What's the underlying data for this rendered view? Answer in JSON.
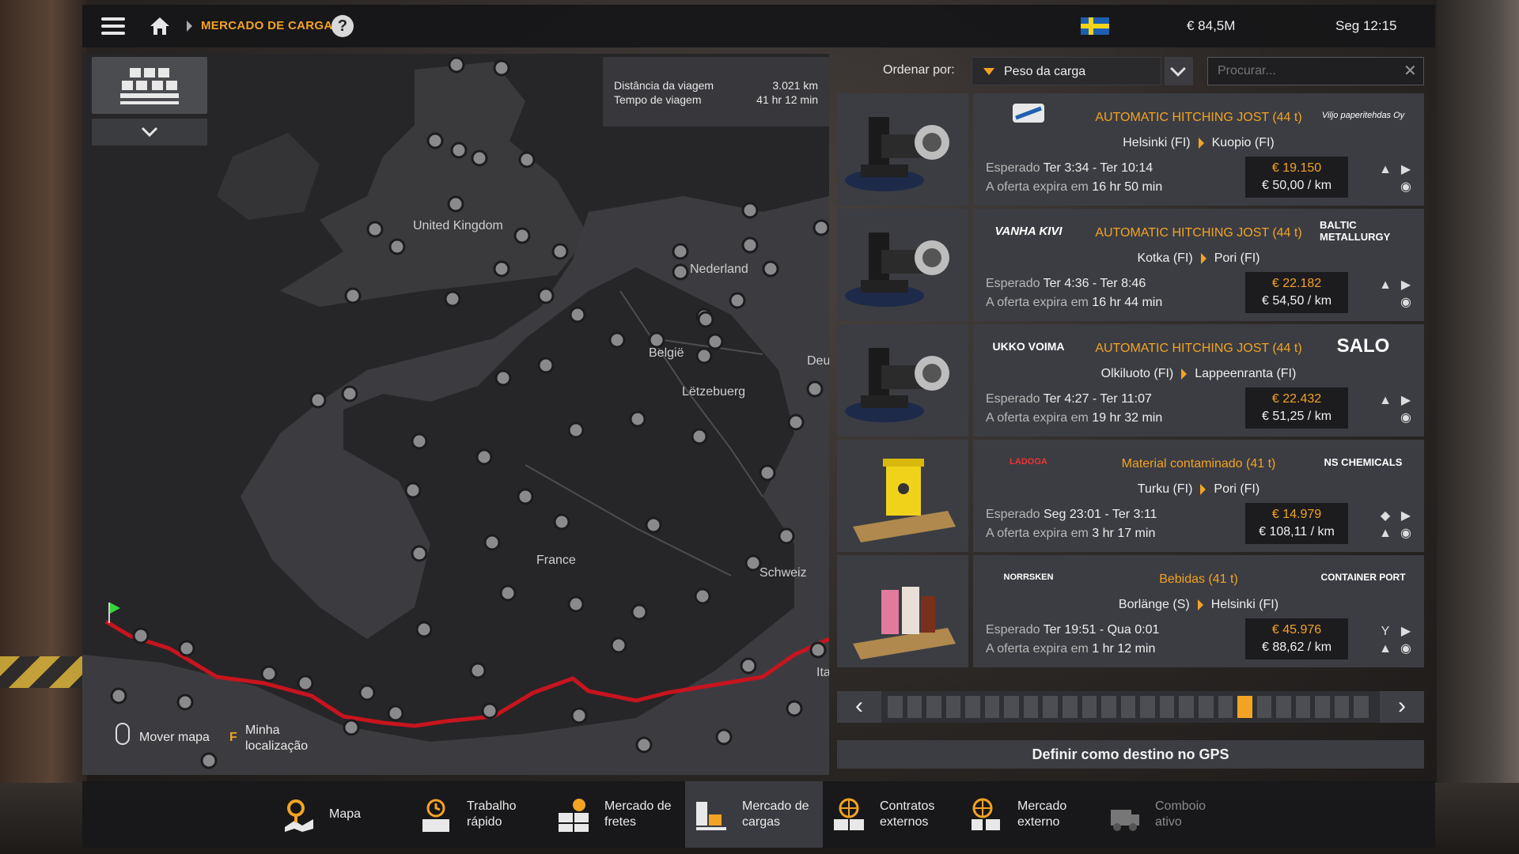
{
  "topbar": {
    "breadcrumb": "MERCADO DE CARGAS",
    "help": "?",
    "money": "€ 84,5M",
    "clock": "Seg 12:15"
  },
  "map": {
    "trip_distance_label": "Distância da viagem",
    "trip_distance_value": "3.021 km",
    "trip_time_label": "Tempo de viagem",
    "trip_time_value": "41 hr 12 min",
    "labels": [
      "United Kingdom",
      "Nederland",
      "België",
      "Lëtzebuerg",
      "France",
      "Schweiz",
      "Deu",
      "Ita"
    ],
    "move_map": "Mover mapa",
    "my_location_key": "F",
    "my_location": "Minha localização"
  },
  "sort": {
    "label": "Ordenar por:",
    "value": "Peso da carga",
    "search_placeholder": "Procurar..."
  },
  "jobs": [
    {
      "company_from_logo": "FennoBaltica",
      "company_to_logo": "Viljo paperitehdas Oy",
      "cargo": "AUTOMATIC HITCHING JOST (44 t)",
      "from": "Helsinki (FI)",
      "to": "Kuopio (FI)",
      "expected_label": "Esperado",
      "expected": "Ter 3:34 - Ter 10:14",
      "offer_label": "A oferta expira em",
      "offer": "16 hr 50 min",
      "price": "€ 19.150",
      "per_km": "€ 50,00 / km"
    },
    {
      "company_from_logo": "VANHA KIVI",
      "company_to_logo": "BALTIC METALLURGY",
      "cargo": "AUTOMATIC HITCHING JOST (44 t)",
      "from": "Kotka (FI)",
      "to": "Pori (FI)",
      "expected_label": "Esperado",
      "expected": "Ter 4:36 - Ter 8:46",
      "offer_label": "A oferta expira em",
      "offer": "16 hr 44 min",
      "price": "€ 22.182",
      "per_km": "€ 54,50 / km"
    },
    {
      "company_from_logo": "UKKO VOIMA",
      "company_to_logo": "SALO",
      "cargo": "AUTOMATIC HITCHING JOST (44 t)",
      "from": "Olkiluoto (FI)",
      "to": "Lappeenranta (FI)",
      "expected_label": "Esperado",
      "expected": "Ter 4:27 - Ter 11:07",
      "offer_label": "A oferta expira em",
      "offer": "19 hr 32 min",
      "price": "€ 22.432",
      "per_km": "€ 51,25 / km"
    },
    {
      "company_from_logo": "LADOGA",
      "company_to_logo": "NS CHEMICALS",
      "cargo": "Material contaminado (41 t)",
      "from": "Turku (FI)",
      "to": "Pori (FI)",
      "expected_label": "Esperado",
      "expected": "Seg 23:01 - Ter 3:11",
      "offer_label": "A oferta expira em",
      "offer": "3 hr 17 min",
      "price": "€ 14.979",
      "per_km": "€ 108,11 / km"
    },
    {
      "company_from_logo": "NORRSKEN",
      "company_to_logo": "CONTAINER PORT",
      "cargo": "Bebidas (41 t)",
      "from": "Borlänge (S)",
      "to": "Helsinki (FI)",
      "expected_label": "Esperado",
      "expected": "Ter 19:51 - Qua 0:01",
      "offer_label": "A oferta expira em",
      "offer": "1 hr 12 min",
      "price": "€ 45.976",
      "per_km": "€ 88,62 / km"
    }
  ],
  "pager": {
    "current_page": 19,
    "total_pages": 25
  },
  "gps_button": "Definir como destino no GPS",
  "nav": [
    {
      "label1": "Mapa",
      "label2": "",
      "icon": "map-icon"
    },
    {
      "label1": "Trabalho",
      "label2": "rápido",
      "icon": "quick-job-icon"
    },
    {
      "label1": "Mercado de",
      "label2": "fretes",
      "icon": "freight-market-icon"
    },
    {
      "label1": "Mercado de",
      "label2": "cargas",
      "icon": "cargo-market-icon"
    },
    {
      "label1": "Contratos",
      "label2": "externos",
      "icon": "external-contracts-icon"
    },
    {
      "label1": "Mercado",
      "label2": "externo",
      "icon": "external-market-icon"
    },
    {
      "label1": "Comboio",
      "label2": "ativo",
      "icon": "convoy-icon"
    }
  ],
  "colors": {
    "accent": "#f3a324",
    "route": "#c8141e",
    "panel": "#3b3d42"
  }
}
